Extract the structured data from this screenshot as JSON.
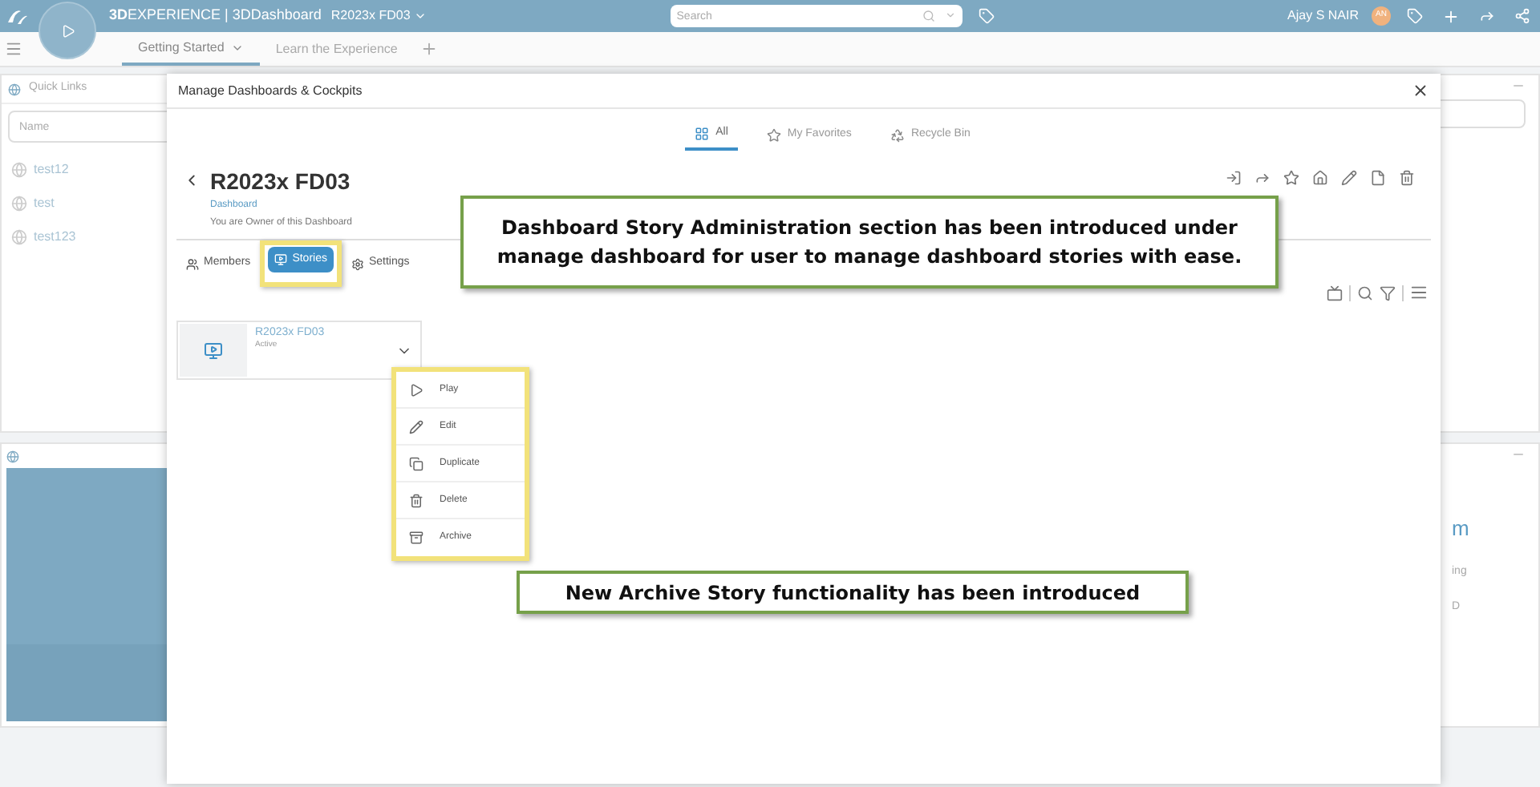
{
  "top_bar": {
    "app_title": "**3D**EXPERIENCE | 3DDashboard",
    "dashboard_name": "R2023x FD03",
    "search": {
      "placeholder": "Search"
    },
    "user_name": "Ajay S NAIR",
    "avatar_initials": "AN"
  },
  "dashboard_tabs": [
    {
      "label": "Getting Started",
      "selected": true
    },
    {
      "label": "Learn the Experience",
      "selected": false
    }
  ],
  "widgets": {
    "quick_links": {
      "title": "Quick Links",
      "search": {
        "placeholder": "Name"
      },
      "items": [
        "test12",
        "test",
        "test123"
      ]
    },
    "right_fragments": [
      "m",
      "ing",
      "D"
    ]
  },
  "dialog": {
    "title": "Manage Dashboards & Cockpits",
    "tabs": [
      {
        "label": "All",
        "selected": true
      },
      {
        "label": "My Favorites",
        "selected": false
      },
      {
        "label": "Recycle Bin",
        "selected": false
      }
    ],
    "dashboard": {
      "name": "R2023x FD03",
      "type": "Dashboard",
      "ownership": "You are Owner of this Dashboard"
    },
    "sections": [
      {
        "label": "Members",
        "selected": false
      },
      {
        "label": "Stories",
        "selected": true
      },
      {
        "label": "Settings",
        "selected": false
      }
    ],
    "stories": [
      {
        "name": "R2023x FD03",
        "status": "Active",
        "expanded": true
      }
    ],
    "story_menu": [
      "Play",
      "Edit",
      "Duplicate",
      "Delete",
      "Archive"
    ]
  },
  "callouts": [
    "Dashboard Story Administration section has been introduced under manage dashboard for user to manage dashboard stories with ease.",
    "New Archive Story functionality has been introduced"
  ]
}
